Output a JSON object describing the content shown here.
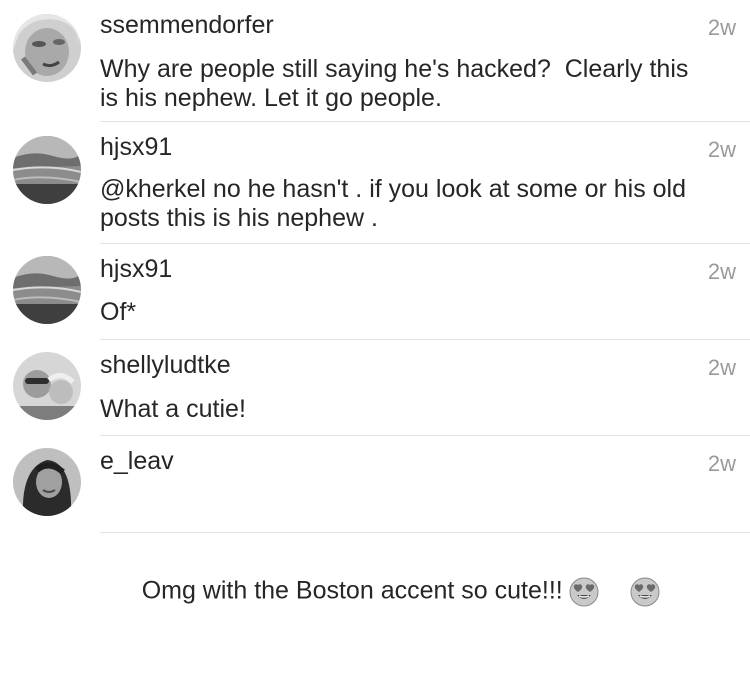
{
  "comments": [
    {
      "username": "ssemmendorfer",
      "time": "2w",
      "text": "Why are people still saying he's hacked?  Clearly this\nis his nephew. Let it go people."
    },
    {
      "username": "hjsx91",
      "time": "2w",
      "text": "@kherkel no he hasn't . if you look at some or his old\nposts this is his nephew ."
    },
    {
      "username": "hjsx91",
      "time": "2w",
      "text": "Of*"
    },
    {
      "username": "shellyludtke",
      "time": "2w",
      "text": "What a cutie!"
    },
    {
      "username": "e_leav",
      "time": "2w",
      "text": "Omg with the Boston accent so cute!!!"
    }
  ],
  "icons": {
    "emoji_1": "heart-eyes-emoji-icon",
    "emoji_2": "heart-eyes-emoji-icon"
  }
}
